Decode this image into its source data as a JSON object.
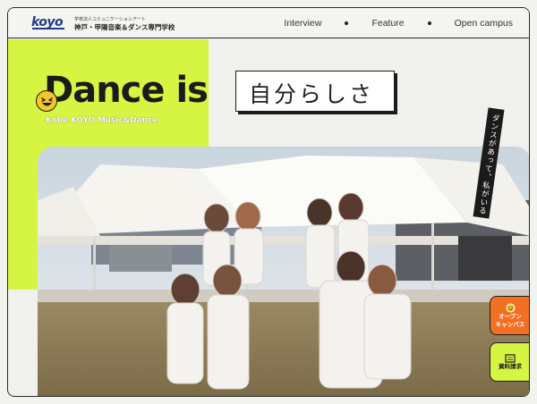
{
  "header": {
    "logo": "koyo",
    "school_line1": "学校法人コミュニケーションアート",
    "school_line2": "神戸・甲陽音楽＆ダンス専門学校",
    "nav": [
      {
        "label": "Interview"
      },
      {
        "label": "Feature"
      },
      {
        "label": "Open campus"
      }
    ]
  },
  "hero": {
    "title": "Dance is",
    "subtitle": "Kobe KOYO Music&Dance",
    "box_text": "自分らしさ",
    "vertical_caption": "ダンスがあって、私がいる"
  },
  "side_buttons": {
    "campus_line1": "オープン",
    "campus_line2": "キャンパス",
    "docs_label": "資料請求"
  },
  "colors": {
    "accent_yellow": "#d6f542",
    "accent_orange": "#f36f22",
    "ink": "#1b1b1b"
  }
}
